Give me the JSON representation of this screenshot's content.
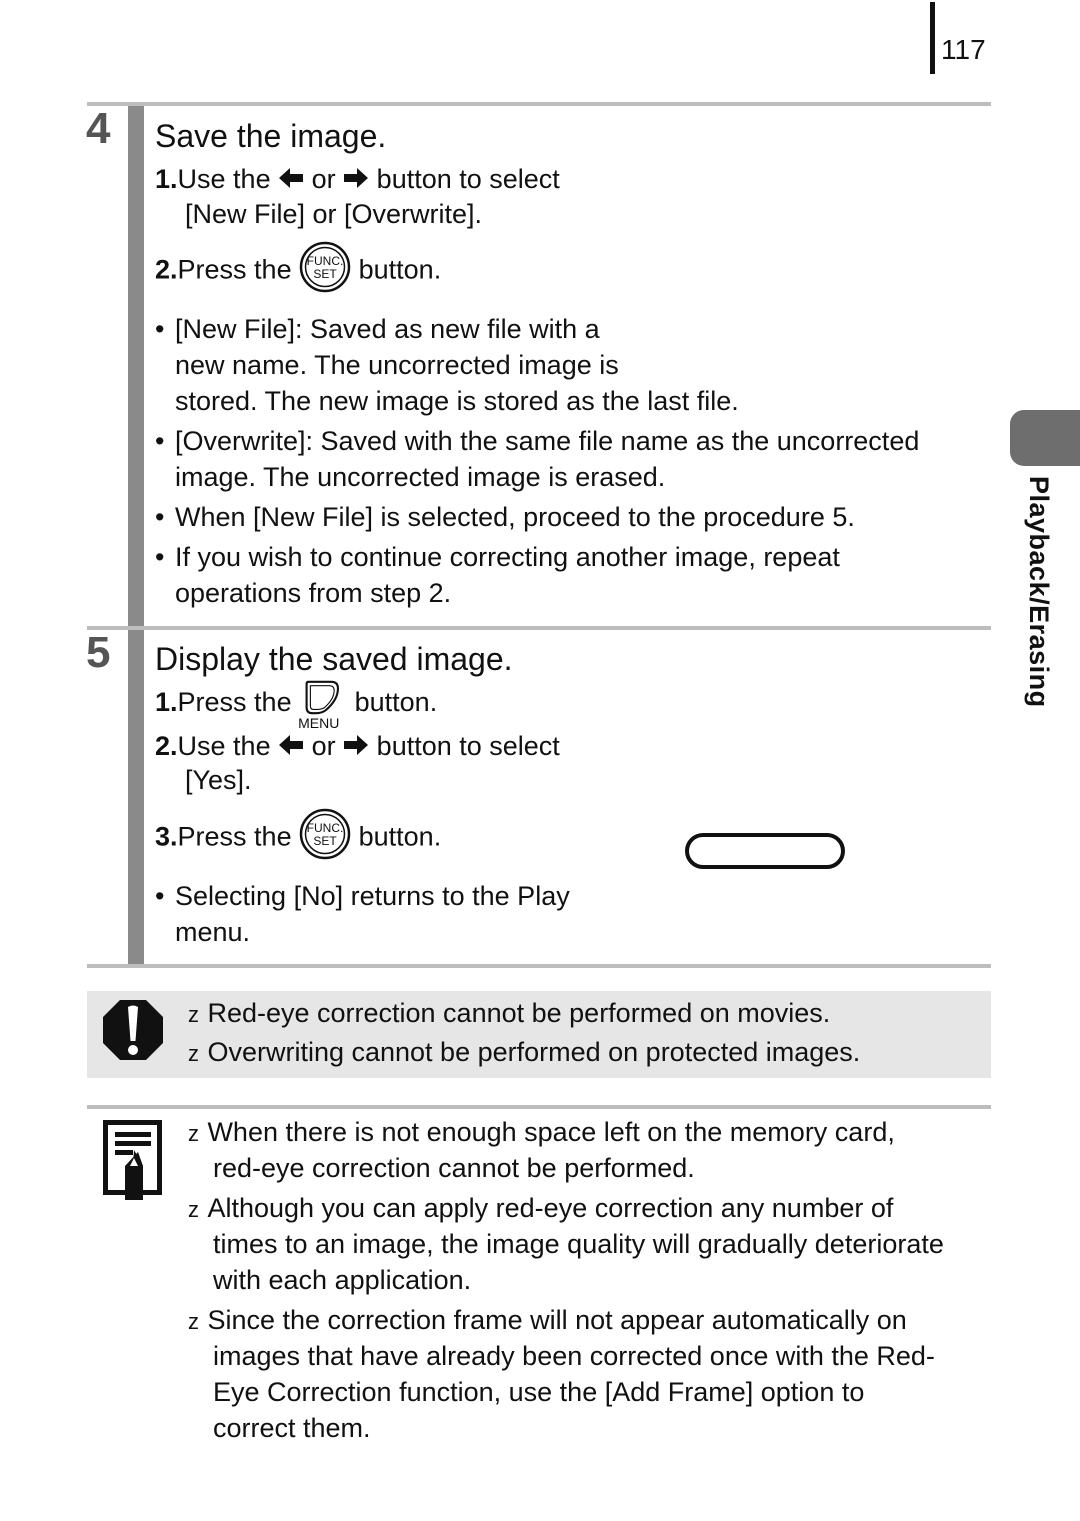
{
  "page": {
    "number": "117",
    "section_tab": "Playback/Erasing"
  },
  "steps": [
    {
      "number": "4",
      "title": "Save the image.",
      "substeps": [
        {
          "n": "1.",
          "parts": [
            "Use the",
            "or",
            "button to select"
          ],
          "cont": "[New File] or [Overwrite].",
          "icons": [
            "left-arrow-icon",
            "right-arrow-icon"
          ]
        },
        {
          "n": "2.",
          "parts": [
            "Press the",
            "button."
          ],
          "icons": [
            "func-set-button-icon"
          ]
        }
      ],
      "bullets": [
        [
          "[New File]: Saved as new file with a",
          "new name. The uncorrected image is",
          "stored. The new image is stored as the last file."
        ],
        [
          "[Overwrite]: Saved with the same file name as the uncorrected",
          "image. The uncorrected image is erased."
        ],
        [
          "When [New File] is selected, proceed to the procedure 5."
        ],
        [
          "If you wish to continue correcting another image, repeat",
          "operations from step 2."
        ]
      ]
    },
    {
      "number": "5",
      "title": "Display the saved image.",
      "substeps": [
        {
          "n": "1.",
          "parts": [
            "Press the",
            "button."
          ],
          "icons": [
            "menu-button-icon"
          ],
          "icon_label": "MENU"
        },
        {
          "n": "2.",
          "parts": [
            "Use the",
            "or",
            "button to select"
          ],
          "cont": "[Yes].",
          "icons": [
            "left-arrow-icon",
            "right-arrow-icon"
          ]
        },
        {
          "n": "3.",
          "parts": [
            "Press the",
            "button."
          ],
          "icons": [
            "func-set-button-icon"
          ]
        }
      ],
      "bullets": [
        [
          "Selecting [No] returns to the Play",
          "menu."
        ]
      ]
    }
  ],
  "func_set_icon": {
    "top": "FUNC.",
    "bottom": "SET"
  },
  "caution": {
    "marker": "z",
    "items": [
      "Red-eye correction cannot be performed on movies.",
      "Overwriting cannot be performed on protected images."
    ]
  },
  "notes": {
    "marker": "z",
    "items": [
      [
        "When there is not enough space left on the memory card,",
        "red-eye correction cannot be performed."
      ],
      [
        "Although you can apply red-eye correction any number of",
        "times to an image, the image quality will gradually deteriorate",
        "with each application."
      ],
      [
        "Since the correction frame will not appear automatically on",
        "images that have already been corrected once with the Red-",
        "Eye Correction function, use the [Add Frame] option to",
        "correct them."
      ]
    ]
  },
  "colors": {
    "step_bar": "#8a8a8a",
    "rule": "#bdbdbd",
    "caution_bg": "#e6e6e6",
    "side_tab": "#6e6e6e"
  }
}
